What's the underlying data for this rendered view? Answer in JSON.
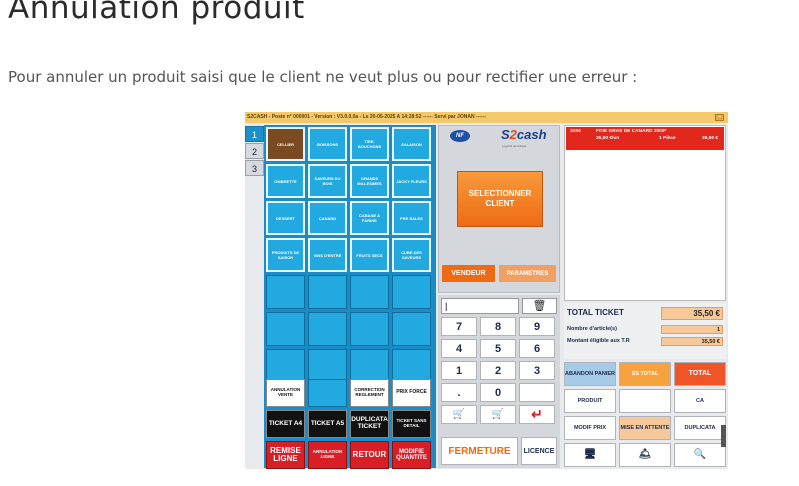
{
  "doc": {
    "title": "Annulation produit",
    "intro": "Pour annuler un produit saisi que le client ne veut plus ou pour rectifier une erreur :"
  },
  "app": {
    "titlebar": "S2CASH - Poste n° 000001 - Version : V3.0.0.0a - Le 20-05-2025 A 14:28:52 ------ Servi par JONAN ------",
    "titlebar_btn": "–"
  },
  "tabs": [
    "1",
    "2",
    "3"
  ],
  "products": [
    "CELLIER",
    "BOISSONS",
    "TIRE-BOUCHONS",
    "SALAISON",
    "OMBRETTE",
    "SAVEURS DU BOIS",
    "GRANDS MILLESIMES",
    "JACKY FLEURS",
    "DESSERT",
    "CANARD",
    "CABANE A FARINE",
    "PRE SALES",
    "PRODUITS DE SAISON",
    "VINS D'ENTRE",
    "FRUITS SECS",
    "CUBE DES SAVEURS"
  ],
  "actions": {
    "annulation_vente": "ANNULATION VENTE",
    "correction_reglement": "CORRECTION REGLEMENT",
    "prix_force": "PRIX FORCE",
    "ticket_a4": "TICKET A4",
    "ticket_a5": "TICKET A5",
    "duplicata_ticket": "DUPLICATA TICKET",
    "ticket_sans_detail": "TICKET SANS DETAIL",
    "remise_ligne": "REMISE LIGNE",
    "annulation_ligne": "ANNULATION LIGNE",
    "retour": "RETOUR",
    "modifie_quantite": "MODIFIE QUANTITE"
  },
  "middle": {
    "nf_logo": "NF",
    "brand_s": "S",
    "brand_2": "2",
    "brand_cash": "cash",
    "brand_sub": "Logiciel de Caisse",
    "client_button": "SELECTIONNER CLIENT",
    "vendeur": "VENDEUR",
    "parametres": "PARAMETRES"
  },
  "keypad": {
    "display": "|",
    "keys": [
      "7",
      "8",
      "9",
      "4",
      "5",
      "6",
      "1",
      "2",
      "3",
      ".",
      "0",
      ""
    ],
    "fermeture": "FERMETURE",
    "licence": "LICENCE"
  },
  "ticket": {
    "ref": "3104",
    "name": "FOIE GRAS DE CANARD 2000*",
    "unit_price": "35,50 €/un",
    "qty": "1 Pièce",
    "price": "35,50 €"
  },
  "totals": {
    "total_label": "TOTAL TICKET",
    "total_value": "35,50 €",
    "nb_label": "Nombre d'article(s)",
    "nb_value": "1",
    "tr_label": "Montant éligible aux T.R",
    "tr_value": "35,50 €"
  },
  "functions": {
    "abandon_panier": "ABANDON PANIER",
    "sous_total": "SS TOTAL",
    "total": "TOTAL",
    "produit": "PRODUIT",
    "ca": "CA",
    "modif_prix": "MODIF PRIX",
    "mise_en_attente": "MISE EN ATTENTE",
    "duplicata": "DUPLICATA"
  },
  "icons": {
    "trash": "trash-icon",
    "cart": "cart-icon",
    "enter": "enter-arrow-icon",
    "cashier": "cashier-icon",
    "service_bell": "service-bell-icon",
    "search_ticket": "search-ticket-icon"
  },
  "colors": {
    "product_blue": "#22a9df",
    "orange": "#ee6b15",
    "red": "#d81f26",
    "ticket_red": "#e2271c"
  }
}
